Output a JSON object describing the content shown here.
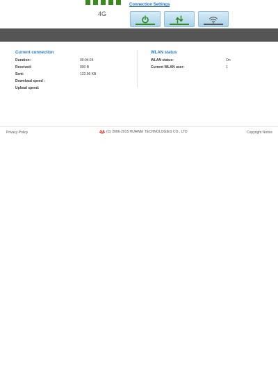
{
  "header": {
    "network_type": "4G",
    "connection_settings_label": "Connection Settings",
    "signal_bars": 5
  },
  "quick_buttons": [
    {
      "name": "connection-power-button",
      "icon": "power-icon",
      "indicator_color": "#3a8a1e"
    },
    {
      "name": "data-transfer-button",
      "icon": "up-down-arrows-icon",
      "indicator_color": "#3a8a1e"
    },
    {
      "name": "wifi-button",
      "icon": "wifi-icon",
      "indicator_color": "#555555"
    }
  ],
  "current_connection": {
    "title": "Current connection",
    "rows": [
      {
        "label": "Duration:",
        "value": "00:04:24"
      },
      {
        "label": "Received:",
        "value": "000 B"
      },
      {
        "label": "Sent:",
        "value": "122.96 KB"
      },
      {
        "label": "Download speed :",
        "value": ""
      },
      {
        "label": "Upload speed:",
        "value": ""
      }
    ]
  },
  "wlan_status": {
    "title": "WLAN status",
    "rows": [
      {
        "label": "WLAN status:",
        "value": "On"
      },
      {
        "label": "Current WLAN user:",
        "value": "1"
      }
    ]
  },
  "footer": {
    "privacy_policy": "Privacy Policy",
    "copyright": "(C) 2006-2015 HUAWEI TECHNOLOGIES CO., LTD",
    "copyright_right": "Copyright Notice"
  },
  "colors": {
    "accent_green": "#3a8a1e",
    "title_blue": "#1f7bd0",
    "band_gray": "#555555",
    "huawei_red": "#d81e06"
  }
}
